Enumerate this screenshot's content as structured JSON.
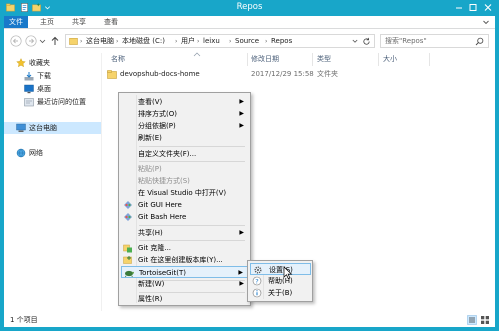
{
  "window": {
    "title": "Repos"
  },
  "ribbon": {
    "tabs": [
      {
        "label": "文件",
        "active": true
      },
      {
        "label": "主页",
        "active": false
      },
      {
        "label": "共享",
        "active": false
      },
      {
        "label": "查看",
        "active": false
      }
    ]
  },
  "address": {
    "crumbs": [
      "这台电脑",
      "本地磁盘 (C:)",
      "用户",
      "leixu",
      "Source",
      "Repos"
    ]
  },
  "search": {
    "placeholder": "搜索\"Repos\""
  },
  "sidebar": {
    "items": [
      {
        "label": "收藏夹",
        "icon": "star-icon"
      },
      {
        "label": "下载",
        "icon": "download-icon"
      },
      {
        "label": "桌面",
        "icon": "desktop-icon"
      },
      {
        "label": "最近访问的位置",
        "icon": "recent-icon"
      },
      {
        "label": "这台电脑",
        "icon": "computer-icon"
      },
      {
        "label": "网络",
        "icon": "network-icon"
      }
    ]
  },
  "columns": {
    "name": "名称",
    "modified": "修改日期",
    "type": "类型",
    "size": "大小"
  },
  "files": [
    {
      "name": "devopshub-docs-home",
      "modified": "2017/12/29 15:58",
      "type": "文件夹",
      "size": ""
    }
  ],
  "status": {
    "count_text": "1 个项目"
  },
  "context_menu": {
    "items": [
      {
        "label": "查看(V)"
      },
      {
        "label": "排序方式(O)"
      },
      {
        "label": "分组依据(P)"
      },
      {
        "label": "刷新(E)"
      },
      {
        "label": "自定义文件夹(F)..."
      },
      {
        "label": "粘贴(P)"
      },
      {
        "label": "粘贴快捷方式(S)"
      },
      {
        "label": "在 Visual Studio 中打开(V)"
      },
      {
        "label": "Git GUI Here"
      },
      {
        "label": "Git Bash Here"
      },
      {
        "label": "共享(H)"
      },
      {
        "label": "Git 克隆..."
      },
      {
        "label": "Git 在这里创建版本库(Y)..."
      },
      {
        "label": "TortoiseGit(T)"
      },
      {
        "label": "新建(W)"
      },
      {
        "label": "属性(R)"
      }
    ]
  },
  "submenu": {
    "items": [
      {
        "label": "设置(S)"
      },
      {
        "label": "帮助(H)"
      },
      {
        "label": "关于(B)"
      }
    ]
  },
  "colors": {
    "titlebar": "#18a6c9",
    "ribbon_active": "#1979ca",
    "selection": "#cce8ff",
    "menu_highlight": "#e5f1fb"
  }
}
